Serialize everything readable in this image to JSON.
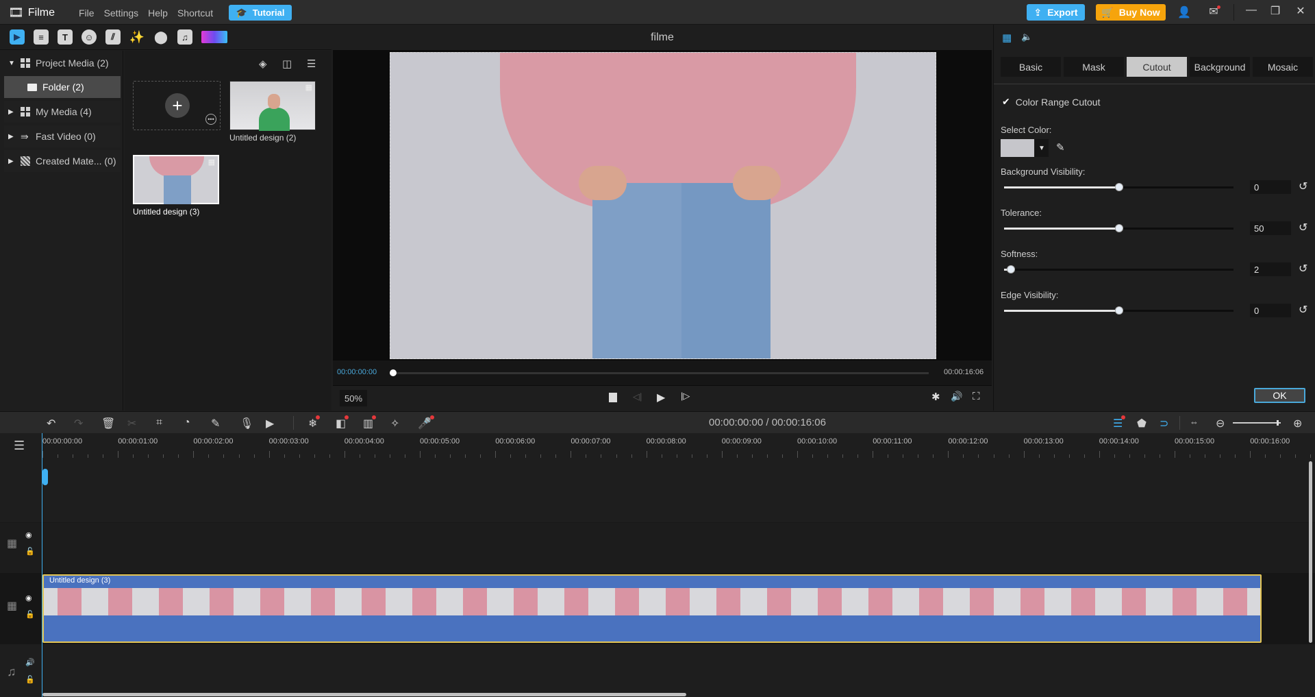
{
  "app": {
    "name": "Filme"
  },
  "menu": [
    "File",
    "Settings",
    "Help",
    "Shortcut"
  ],
  "titlebar": {
    "tutorial_label": "Tutorial",
    "export_label": "Export",
    "buy_label": "Buy Now",
    "icons": [
      "account-icon",
      "mail-icon",
      "minimize-icon",
      "restore-icon",
      "close-icon"
    ]
  },
  "media_toolbar": {
    "icons": [
      "media-icon",
      "files-icon",
      "text-icon",
      "sticker-icon",
      "transition-icon",
      "effects-icon",
      "filters-icon",
      "audio-icon",
      "color-gradient-icon"
    ]
  },
  "tree": {
    "items": [
      {
        "label": "Project Media (2)",
        "expanded": true
      },
      {
        "label": "Folder (2)",
        "selected": true
      },
      {
        "label": "My Media (4)"
      },
      {
        "label": "Fast Video (0)"
      },
      {
        "label": "Created Mate... (0)"
      }
    ]
  },
  "media": {
    "items": [
      {
        "label": "Untitled design (2)"
      },
      {
        "label": "Untitled design (3)",
        "selected": true
      }
    ]
  },
  "preview": {
    "title": "filme",
    "current_time": "00:00:00:00",
    "total_time": "00:00:16:06",
    "zoom": "50%",
    "progress": 0
  },
  "props": {
    "tabs": [
      "Basic",
      "Mask",
      "Cutout",
      "Background",
      "Mosaic"
    ],
    "active_tab": "Cutout",
    "color_range_cutout_label": "Color Range Cutout",
    "color_range_cutout_checked": true,
    "select_color_label": "Select Color:",
    "selected_color": "#c6c6cb",
    "sliders": [
      {
        "label": "Background Visibility:",
        "value": "0",
        "fraction": 0.5
      },
      {
        "label": "Tolerance:",
        "value": "50",
        "fraction": 0.5
      },
      {
        "label": "Softness:",
        "value": "2",
        "fraction": 0.03
      },
      {
        "label": "Edge Visibility:",
        "value": "0",
        "fraction": 0.5
      }
    ],
    "ok_label": "OK"
  },
  "timeline": {
    "timecode": "00:00:00:00 / 00:00:16:06",
    "ruler": [
      "00:00:00:00",
      "00:00:01:00",
      "00:00:02:00",
      "00:00:03:00",
      "00:00:04:00",
      "00:00:05:00",
      "00:00:06:00",
      "00:00:07:00",
      "00:00:08:00",
      "00:00:09:00",
      "00:00:10:00",
      "00:00:11:00",
      "00:00:12:00",
      "00:00:13:00",
      "00:00:14:00",
      "00:00:15:00",
      "00:00:16:00"
    ],
    "clip_label": "Untitled design (3)",
    "zoom_fraction": 0.92
  }
}
